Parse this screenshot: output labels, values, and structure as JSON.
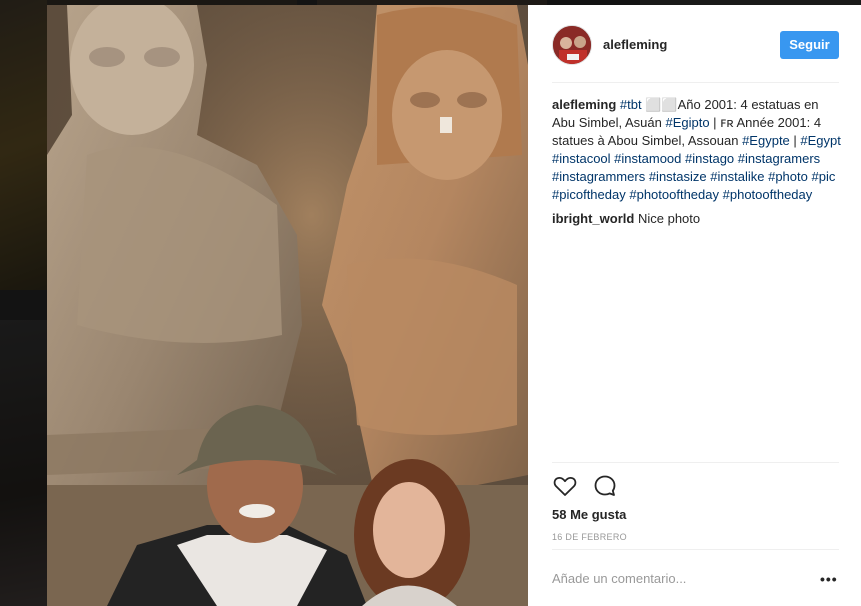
{
  "post": {
    "username": "alefleming",
    "follow_label": "Seguir",
    "caption": {
      "user": "alefleming",
      "parts": [
        {
          "t": "tag",
          "v": "#tbt"
        },
        {
          "t": "text",
          "v": " ⬜⬜Año 2001: 4 estatuas en Abu Simbel, Asuán "
        },
        {
          "t": "tag",
          "v": "#Egipto"
        },
        {
          "t": "text",
          "v": " | ꜰʀ Année 2001: 4 statues à Abou Simbel, Assouan "
        },
        {
          "t": "tag",
          "v": "#Egypte"
        },
        {
          "t": "text",
          "v": " | "
        },
        {
          "t": "tag",
          "v": "#Egypt"
        },
        {
          "t": "text",
          "v": " "
        },
        {
          "t": "tag",
          "v": "#instacool"
        },
        {
          "t": "text",
          "v": " "
        },
        {
          "t": "tag",
          "v": "#instamood"
        },
        {
          "t": "text",
          "v": " "
        },
        {
          "t": "tag",
          "v": "#instago"
        },
        {
          "t": "text",
          "v": " "
        },
        {
          "t": "tag",
          "v": "#instagramers"
        },
        {
          "t": "text",
          "v": " "
        },
        {
          "t": "tag",
          "v": "#instagrammers"
        },
        {
          "t": "text",
          "v": " "
        },
        {
          "t": "tag",
          "v": "#instasize"
        },
        {
          "t": "text",
          "v": " "
        },
        {
          "t": "tag",
          "v": "#instalike"
        },
        {
          "t": "text",
          "v": " "
        },
        {
          "t": "tag",
          "v": "#photo"
        },
        {
          "t": "text",
          "v": " "
        },
        {
          "t": "tag",
          "v": "#pic"
        },
        {
          "t": "text",
          "v": " "
        },
        {
          "t": "tag",
          "v": "#picoftheday"
        },
        {
          "t": "text",
          "v": " "
        },
        {
          "t": "tag",
          "v": "#photooftheday"
        },
        {
          "t": "text",
          "v": " "
        },
        {
          "t": "tag",
          "v": "#photooftheday"
        }
      ]
    },
    "comments": [
      {
        "user": "ibright_world",
        "text": "Nice photo"
      }
    ],
    "likes": "58 Me gusta",
    "date": "16 DE FEBRERO",
    "add_comment_placeholder": "Añade un comentario...",
    "more_label": "•••",
    "icons": {
      "like": "heart-icon",
      "comment": "comment-bubble-icon",
      "more": "ellipsis-icon"
    },
    "colors": {
      "follow_button": "#3897f0",
      "hashtag": "#003569",
      "muted": "#999999",
      "text": "#262626"
    }
  }
}
